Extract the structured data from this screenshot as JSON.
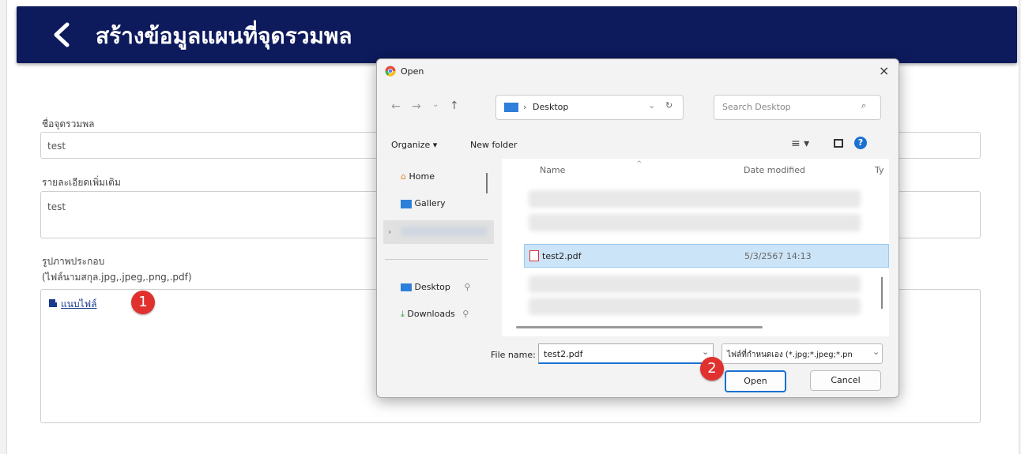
{
  "header": {
    "title": "สร้างข้อมูลแผนที่จุดรวมพล"
  },
  "form": {
    "name_label": "ชื่อจุดรวมพล",
    "name_value": "test",
    "detail_label": "รายละเอียดเพิ่มเติม",
    "detail_value": "test",
    "image_label": "รูปภาพประกอบ",
    "image_hint": "(ไฟล์นามสกุล.jpg,.jpeg,.png,.pdf)",
    "attach_label": "แนบไฟล์"
  },
  "badges": {
    "one": "1",
    "two": "2"
  },
  "dialog": {
    "title": "Open",
    "close": "×",
    "path": "Desktop",
    "search_placeholder": "Search Desktop",
    "organize": "Organize ▾",
    "new_folder": "New folder",
    "nav": {
      "home": "Home",
      "gallery": "Gallery",
      "desktop": "Desktop",
      "downloads": "Downloads"
    },
    "columns": {
      "name": "Name",
      "date": "Date modified",
      "type": "Ty"
    },
    "selected_file": {
      "name": "test2.pdf",
      "date": "5/3/2567 14:13"
    },
    "filename_label": "File name:",
    "filename_value": "test2.pdf",
    "filetype": "ไฟล์ที่กำหนดเอง (*.jpg;*.jpeg;*.pn",
    "open_btn": "Open",
    "cancel_btn": "Cancel"
  },
  "colors": {
    "header_bg": "#0d1a5c",
    "badge": "#e0312f",
    "selected_row": "#cce4f7"
  }
}
